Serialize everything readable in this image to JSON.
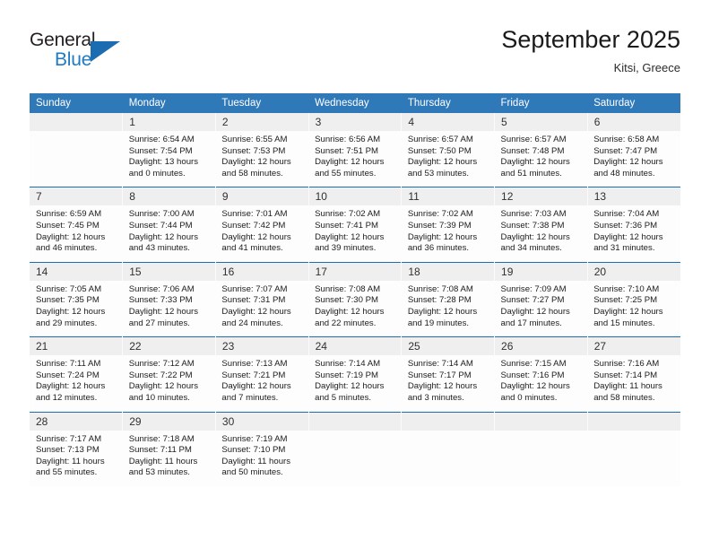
{
  "brand": {
    "name_part1": "General",
    "name_part2": "Blue",
    "triangle_color": "#1b6cb0",
    "blue_color": "#1f7ac4"
  },
  "header": {
    "title": "September 2025",
    "subtitle": "Kitsi, Greece",
    "accent_color": "#3079b9"
  },
  "weekdays": [
    "Sunday",
    "Monday",
    "Tuesday",
    "Wednesday",
    "Thursday",
    "Friday",
    "Saturday"
  ],
  "weeks": [
    [
      {
        "day": "",
        "sunrise": "",
        "sunset": "",
        "daylight1": "",
        "daylight2": ""
      },
      {
        "day": "1",
        "sunrise": "Sunrise: 6:54 AM",
        "sunset": "Sunset: 7:54 PM",
        "daylight1": "Daylight: 13 hours",
        "daylight2": "and 0 minutes."
      },
      {
        "day": "2",
        "sunrise": "Sunrise: 6:55 AM",
        "sunset": "Sunset: 7:53 PM",
        "daylight1": "Daylight: 12 hours",
        "daylight2": "and 58 minutes."
      },
      {
        "day": "3",
        "sunrise": "Sunrise: 6:56 AM",
        "sunset": "Sunset: 7:51 PM",
        "daylight1": "Daylight: 12 hours",
        "daylight2": "and 55 minutes."
      },
      {
        "day": "4",
        "sunrise": "Sunrise: 6:57 AM",
        "sunset": "Sunset: 7:50 PM",
        "daylight1": "Daylight: 12 hours",
        "daylight2": "and 53 minutes."
      },
      {
        "day": "5",
        "sunrise": "Sunrise: 6:57 AM",
        "sunset": "Sunset: 7:48 PM",
        "daylight1": "Daylight: 12 hours",
        "daylight2": "and 51 minutes."
      },
      {
        "day": "6",
        "sunrise": "Sunrise: 6:58 AM",
        "sunset": "Sunset: 7:47 PM",
        "daylight1": "Daylight: 12 hours",
        "daylight2": "and 48 minutes."
      }
    ],
    [
      {
        "day": "7",
        "sunrise": "Sunrise: 6:59 AM",
        "sunset": "Sunset: 7:45 PM",
        "daylight1": "Daylight: 12 hours",
        "daylight2": "and 46 minutes."
      },
      {
        "day": "8",
        "sunrise": "Sunrise: 7:00 AM",
        "sunset": "Sunset: 7:44 PM",
        "daylight1": "Daylight: 12 hours",
        "daylight2": "and 43 minutes."
      },
      {
        "day": "9",
        "sunrise": "Sunrise: 7:01 AM",
        "sunset": "Sunset: 7:42 PM",
        "daylight1": "Daylight: 12 hours",
        "daylight2": "and 41 minutes."
      },
      {
        "day": "10",
        "sunrise": "Sunrise: 7:02 AM",
        "sunset": "Sunset: 7:41 PM",
        "daylight1": "Daylight: 12 hours",
        "daylight2": "and 39 minutes."
      },
      {
        "day": "11",
        "sunrise": "Sunrise: 7:02 AM",
        "sunset": "Sunset: 7:39 PM",
        "daylight1": "Daylight: 12 hours",
        "daylight2": "and 36 minutes."
      },
      {
        "day": "12",
        "sunrise": "Sunrise: 7:03 AM",
        "sunset": "Sunset: 7:38 PM",
        "daylight1": "Daylight: 12 hours",
        "daylight2": "and 34 minutes."
      },
      {
        "day": "13",
        "sunrise": "Sunrise: 7:04 AM",
        "sunset": "Sunset: 7:36 PM",
        "daylight1": "Daylight: 12 hours",
        "daylight2": "and 31 minutes."
      }
    ],
    [
      {
        "day": "14",
        "sunrise": "Sunrise: 7:05 AM",
        "sunset": "Sunset: 7:35 PM",
        "daylight1": "Daylight: 12 hours",
        "daylight2": "and 29 minutes."
      },
      {
        "day": "15",
        "sunrise": "Sunrise: 7:06 AM",
        "sunset": "Sunset: 7:33 PM",
        "daylight1": "Daylight: 12 hours",
        "daylight2": "and 27 minutes."
      },
      {
        "day": "16",
        "sunrise": "Sunrise: 7:07 AM",
        "sunset": "Sunset: 7:31 PM",
        "daylight1": "Daylight: 12 hours",
        "daylight2": "and 24 minutes."
      },
      {
        "day": "17",
        "sunrise": "Sunrise: 7:08 AM",
        "sunset": "Sunset: 7:30 PM",
        "daylight1": "Daylight: 12 hours",
        "daylight2": "and 22 minutes."
      },
      {
        "day": "18",
        "sunrise": "Sunrise: 7:08 AM",
        "sunset": "Sunset: 7:28 PM",
        "daylight1": "Daylight: 12 hours",
        "daylight2": "and 19 minutes."
      },
      {
        "day": "19",
        "sunrise": "Sunrise: 7:09 AM",
        "sunset": "Sunset: 7:27 PM",
        "daylight1": "Daylight: 12 hours",
        "daylight2": "and 17 minutes."
      },
      {
        "day": "20",
        "sunrise": "Sunrise: 7:10 AM",
        "sunset": "Sunset: 7:25 PM",
        "daylight1": "Daylight: 12 hours",
        "daylight2": "and 15 minutes."
      }
    ],
    [
      {
        "day": "21",
        "sunrise": "Sunrise: 7:11 AM",
        "sunset": "Sunset: 7:24 PM",
        "daylight1": "Daylight: 12 hours",
        "daylight2": "and 12 minutes."
      },
      {
        "day": "22",
        "sunrise": "Sunrise: 7:12 AM",
        "sunset": "Sunset: 7:22 PM",
        "daylight1": "Daylight: 12 hours",
        "daylight2": "and 10 minutes."
      },
      {
        "day": "23",
        "sunrise": "Sunrise: 7:13 AM",
        "sunset": "Sunset: 7:21 PM",
        "daylight1": "Daylight: 12 hours",
        "daylight2": "and 7 minutes."
      },
      {
        "day": "24",
        "sunrise": "Sunrise: 7:14 AM",
        "sunset": "Sunset: 7:19 PM",
        "daylight1": "Daylight: 12 hours",
        "daylight2": "and 5 minutes."
      },
      {
        "day": "25",
        "sunrise": "Sunrise: 7:14 AM",
        "sunset": "Sunset: 7:17 PM",
        "daylight1": "Daylight: 12 hours",
        "daylight2": "and 3 minutes."
      },
      {
        "day": "26",
        "sunrise": "Sunrise: 7:15 AM",
        "sunset": "Sunset: 7:16 PM",
        "daylight1": "Daylight: 12 hours",
        "daylight2": "and 0 minutes."
      },
      {
        "day": "27",
        "sunrise": "Sunrise: 7:16 AM",
        "sunset": "Sunset: 7:14 PM",
        "daylight1": "Daylight: 11 hours",
        "daylight2": "and 58 minutes."
      }
    ],
    [
      {
        "day": "28",
        "sunrise": "Sunrise: 7:17 AM",
        "sunset": "Sunset: 7:13 PM",
        "daylight1": "Daylight: 11 hours",
        "daylight2": "and 55 minutes."
      },
      {
        "day": "29",
        "sunrise": "Sunrise: 7:18 AM",
        "sunset": "Sunset: 7:11 PM",
        "daylight1": "Daylight: 11 hours",
        "daylight2": "and 53 minutes."
      },
      {
        "day": "30",
        "sunrise": "Sunrise: 7:19 AM",
        "sunset": "Sunset: 7:10 PM",
        "daylight1": "Daylight: 11 hours",
        "daylight2": "and 50 minutes."
      },
      {
        "day": "",
        "sunrise": "",
        "sunset": "",
        "daylight1": "",
        "daylight2": ""
      },
      {
        "day": "",
        "sunrise": "",
        "sunset": "",
        "daylight1": "",
        "daylight2": ""
      },
      {
        "day": "",
        "sunrise": "",
        "sunset": "",
        "daylight1": "",
        "daylight2": ""
      },
      {
        "day": "",
        "sunrise": "",
        "sunset": "",
        "daylight1": "",
        "daylight2": ""
      }
    ]
  ]
}
